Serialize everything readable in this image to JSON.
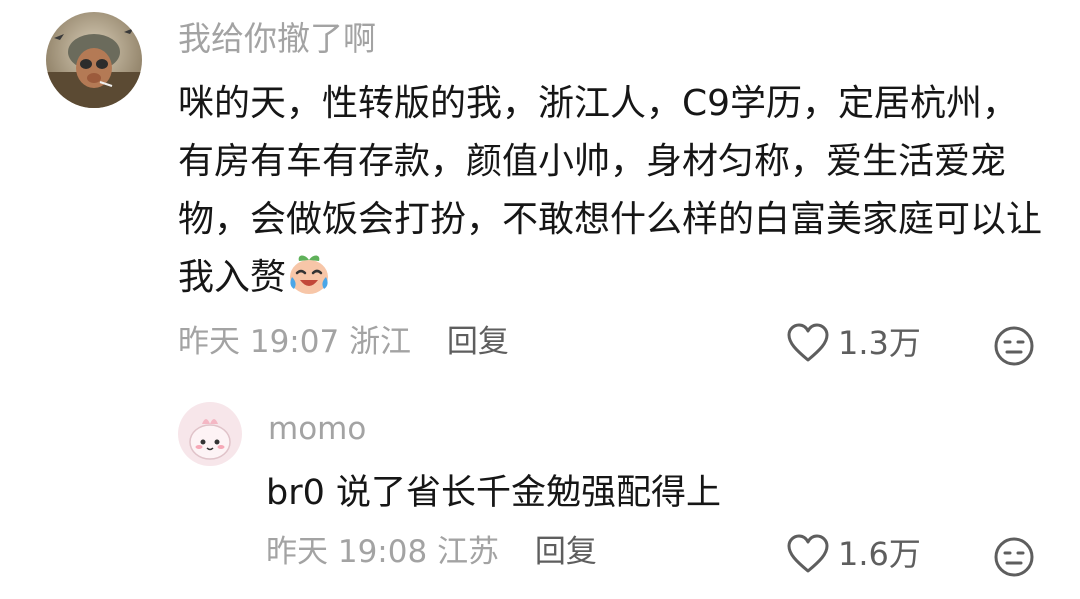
{
  "comments": [
    {
      "username": "我给你撤了啊",
      "avatar_icon": "soldier-avatar-icon",
      "text": "咪的天，性转版的我，浙江人，C9学历，定居杭州，有房有车有存款，颜值小帅，身材匀称，爱生活爱宠物，会做饭会打扮，不敢想什么样的白富美家庭可以让我入赘",
      "emoji": "crying-laughing-peach-emoji",
      "time": "昨天 19:07",
      "location": "浙江",
      "reply_label": "回复",
      "like_count": "1.3万"
    },
    {
      "username": "momo",
      "avatar_icon": "pink-bunny-avatar-icon",
      "text": "br0 说了省长千金勉强配得上",
      "time": "昨天 19:08",
      "location": "江苏",
      "reply_label": "回复",
      "like_count": "1.6万"
    }
  ],
  "colors": {
    "text": "#161616",
    "muted": "#a3a3a3",
    "action": "#5e5e5e"
  }
}
